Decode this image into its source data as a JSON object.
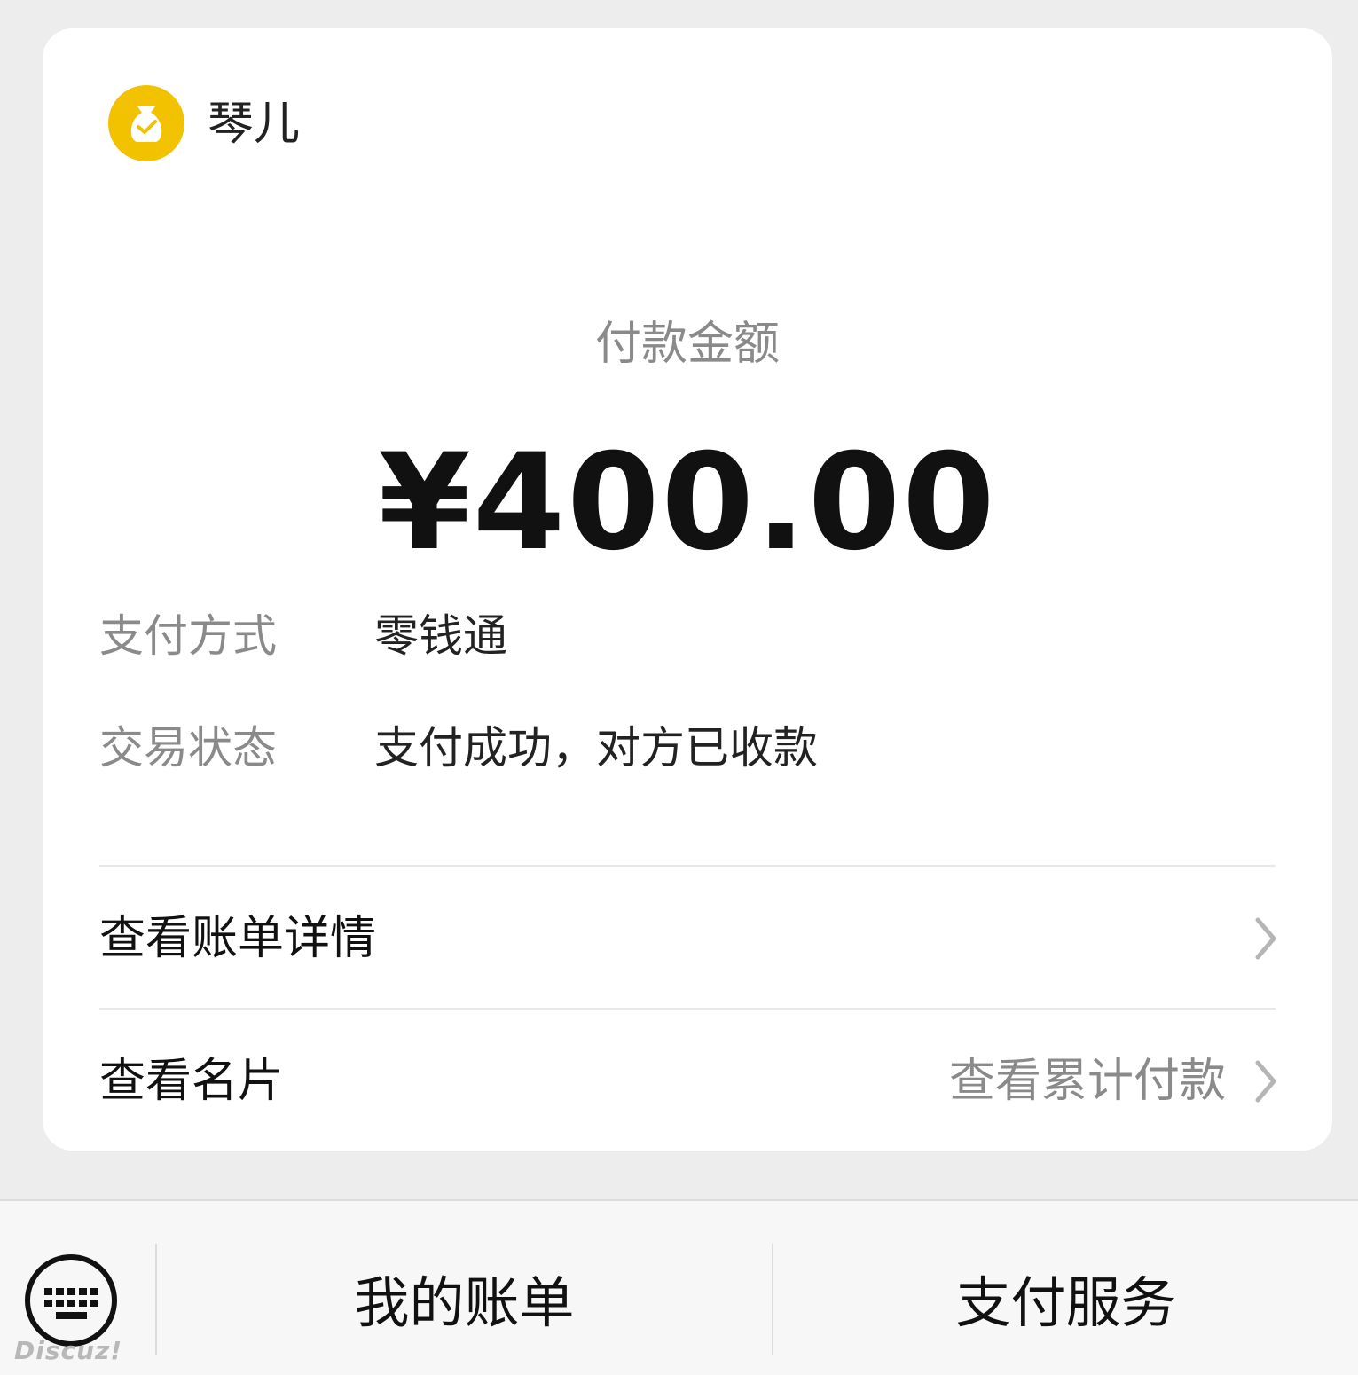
{
  "merchant": {
    "name": "琴儿",
    "logo_icon": "money-bag-check-icon",
    "logo_color": "#f2c200"
  },
  "payment": {
    "amount_label": "付款金额",
    "amount": "¥400.00",
    "method_label": "支付方式",
    "method_value": "零钱通",
    "status_label": "交易状态",
    "status_value": "支付成功，对方已收款"
  },
  "links": {
    "bill_details": "查看账单详情",
    "profile_card": "查看名片",
    "cumulative_payments": "查看累计付款"
  },
  "bottom_bar": {
    "keyboard_icon": "keyboard-icon",
    "my_bills": "我的账单",
    "payment_services": "支付服务"
  },
  "watermark": "Discuz!"
}
